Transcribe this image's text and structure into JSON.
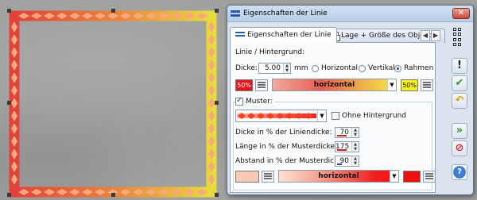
{
  "window": {
    "title": "Eigenschaften der Linie"
  },
  "tabs": [
    {
      "label": "Eigenschaften der Linie",
      "active": true
    },
    {
      "label": "Lage + Größe des Objektes",
      "active": false
    }
  ],
  "tab_scroll": {
    "left": "◀",
    "right": "▶"
  },
  "line_section": {
    "heading": "Linie / Hintergrund:",
    "thickness_label": "Dicke:",
    "thickness_value": "5.00",
    "thickness_unit": "mm",
    "radio_options": [
      {
        "label": "Horizontal",
        "checked": false
      },
      {
        "label": "Vertikal",
        "checked": false
      },
      {
        "label": "Rahmen",
        "checked": true
      }
    ],
    "color_left": {
      "label": "50%",
      "color": "#e8141c"
    },
    "gradient_label": "horizontal",
    "color_right": {
      "label": "50%",
      "color": "#f4f21c"
    }
  },
  "pattern_section": {
    "checkbox_label": "Muster:",
    "checked": true,
    "no_background_label": "Ohne Hintergrund",
    "no_background_checked": false,
    "fields": [
      {
        "label": "Dicke in % der Liniendicke:",
        "value": "70"
      },
      {
        "label": "Länge in % der Musterdicke:",
        "value": "175"
      },
      {
        "label": "Abstand in % der Musterdicke:",
        "value": "90"
      }
    ],
    "color_left": "#f8ccb4",
    "gradient_label": "horizontal",
    "color_right": "#ee1010"
  },
  "side_toolbar": [
    {
      "name": "alert-button",
      "glyph": "!",
      "color": "#222"
    },
    {
      "name": "apply-button",
      "glyph": "✔",
      "color": "#2c9a2c"
    },
    {
      "name": "undo-button",
      "glyph": "↶",
      "color": "#e0a000"
    },
    {
      "name": "apply-all-button",
      "glyph": "»",
      "color": "#2c9a2c"
    },
    {
      "name": "cancel-button",
      "glyph": "⊘",
      "color": "#d42020"
    },
    {
      "name": "help-button",
      "glyph": "?",
      "color": "#ffffff"
    }
  ],
  "colors": {
    "frame_red": "#e0413a",
    "frame_yellow": "#e8d93a",
    "diamond": "#f9a77d",
    "title_accent": "#2b5aa8"
  }
}
